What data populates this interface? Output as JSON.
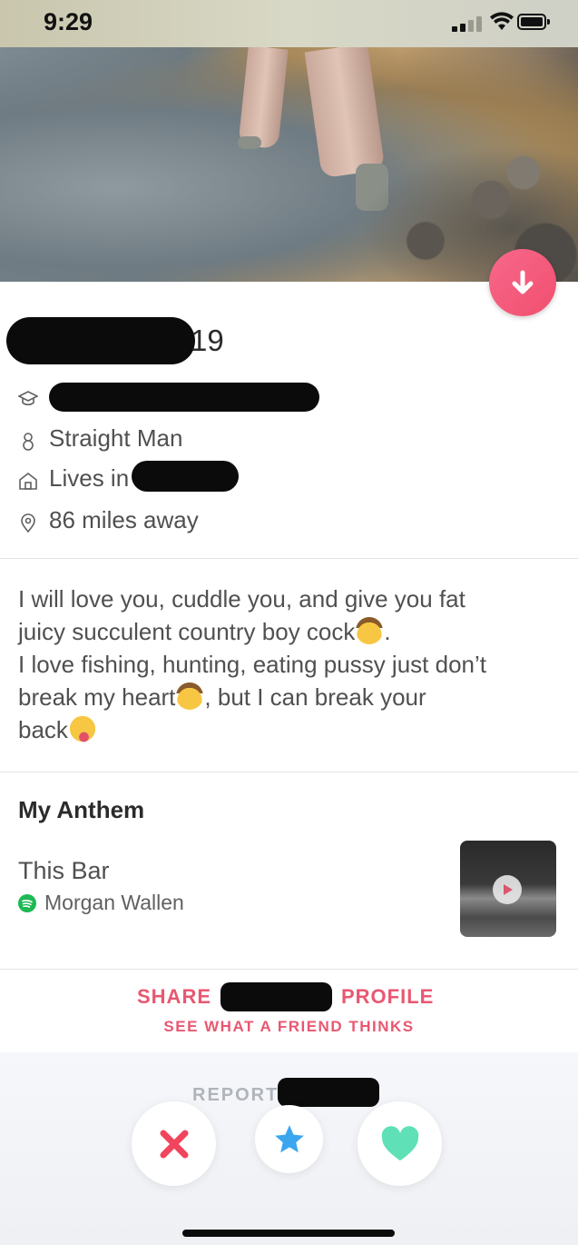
{
  "status_bar": {
    "time": "9:29",
    "battery_icon": "battery-icon",
    "wifi_icon": "wifi-icon",
    "signal_icon": "signal-icon"
  },
  "profile": {
    "age": "19",
    "orientation": "Straight Man",
    "lives_in_prefix": "Lives in",
    "distance": "86 miles away",
    "bio": {
      "line1": "I will love you, cuddle you, and give you fat",
      "line2": "juicy succulent country boy cock",
      "line2_end": ".",
      "line3": "I love fishing, hunting, eating pussy just don’t",
      "line4a": "break my heart",
      "line4b": ", but I can break your",
      "line5": "back"
    }
  },
  "anthem": {
    "title": "My Anthem",
    "song": "This Bar",
    "artist": "Morgan Wallen"
  },
  "share": {
    "share_label": "SHARE",
    "profile_label": "PROFILE",
    "friend_label": "SEE WHAT A FRIEND THINKS"
  },
  "report": {
    "label": "REPORT"
  },
  "colors": {
    "accent": "#e85871",
    "like": "#5fe0b7",
    "super_like": "#3ba6f0",
    "nope": "#f0455c"
  }
}
